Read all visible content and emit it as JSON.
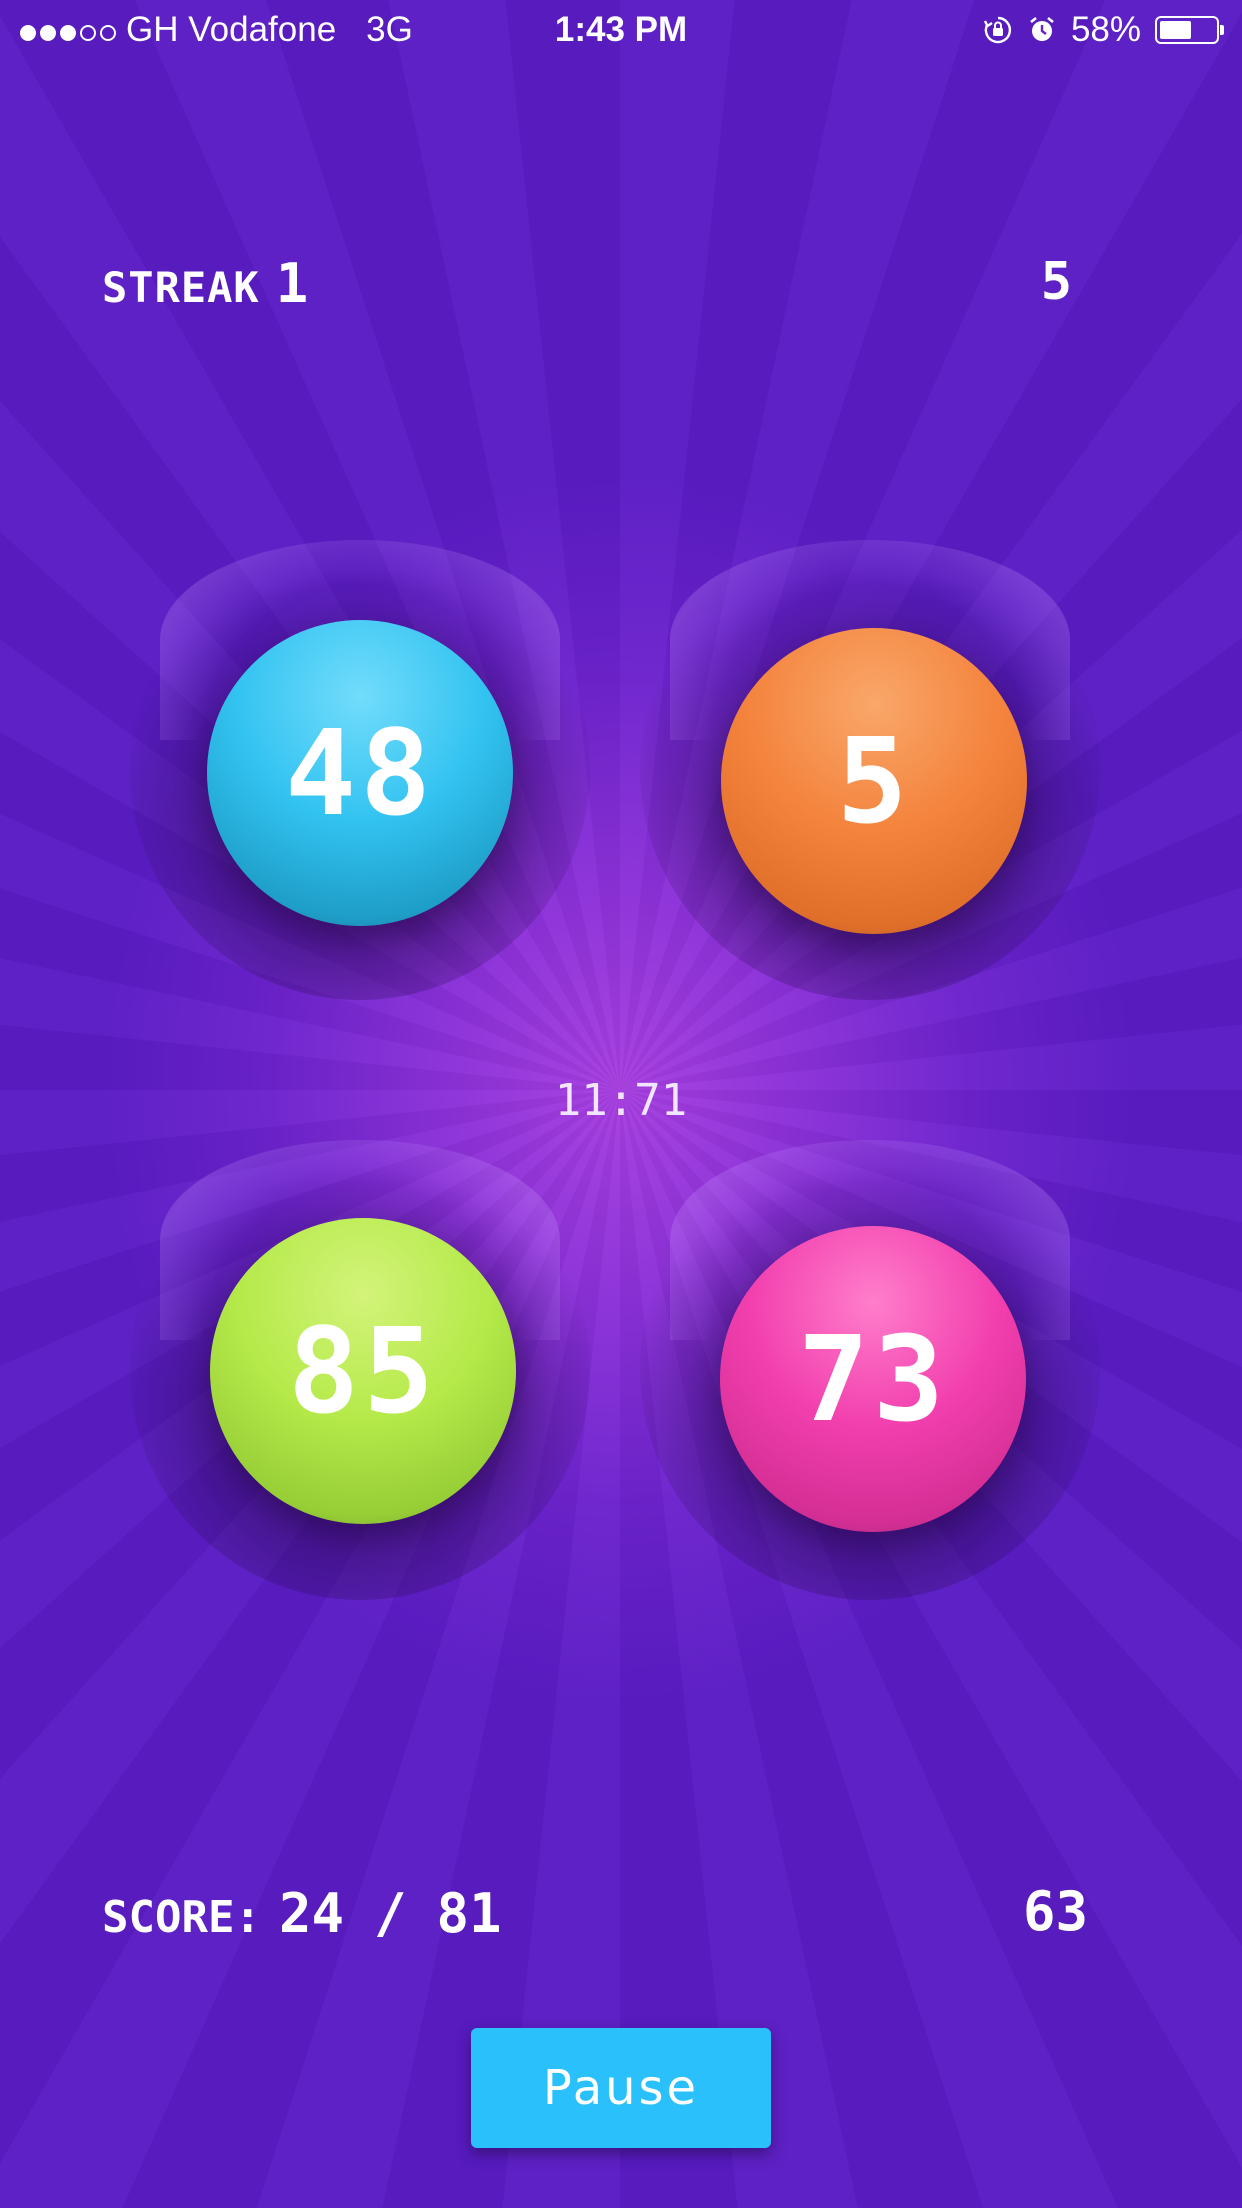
{
  "status_bar": {
    "signal_bars_filled": 3,
    "signal_bars_total": 5,
    "carrier": "GH Vodafone",
    "network": "3G",
    "time": "1:43 PM",
    "battery_percent": "58%",
    "battery_level": 0.58,
    "icons": [
      "orientation-lock-icon",
      "alarm-icon"
    ]
  },
  "header": {
    "streak_label": "STREAK",
    "streak_value": "1",
    "right_value": "5"
  },
  "balls": [
    {
      "value": "48",
      "color": "#33c3f1"
    },
    {
      "value": "5",
      "color": "#f4843e"
    },
    {
      "value": "85",
      "color": "#b5ea4a"
    },
    {
      "value": "73",
      "color": "#f23fae"
    }
  ],
  "timer": "11:71",
  "footer": {
    "score_label": "SCORE:",
    "score_value": "24",
    "score_separator": "/",
    "score_total": "81",
    "right_value": "63"
  },
  "pause_label": "Pause",
  "colors": {
    "background": "#6a22cc",
    "pause_button": "#29c0fb"
  }
}
